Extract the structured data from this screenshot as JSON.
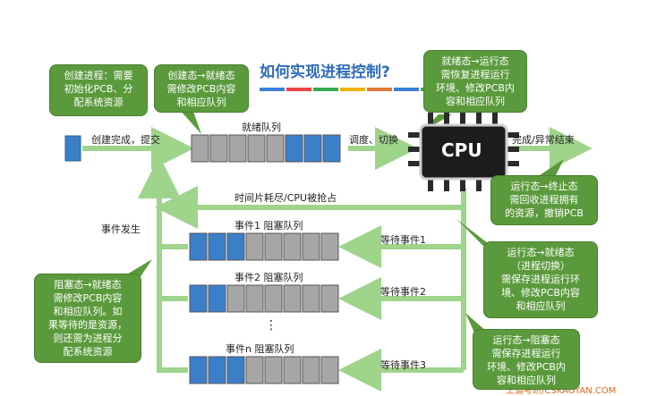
{
  "title": "如何实现进程控制?",
  "title_underline_colors": [
    "#3a7fd5",
    "#e44",
    "#3aaa55",
    "#f0b000",
    "#e07b39",
    "#3a7fd5",
    "#49a34a"
  ],
  "colors": {
    "queue_blue": "#3c7fc9",
    "queue_gray": "#a6a6a6",
    "arrow_green": "#9fd48b",
    "callout_green": "#5b9a3c"
  },
  "callouts": {
    "create": "创建进程：需要\n初始化PCB、分\n配系统资源",
    "ready_to_run_top": "创建态→就绪态\n需修改PCB内容\n和相应队列",
    "ready_to_run": "就绪态→运行态\n需恢复进程运行\n环境、修改PCB内\n容和相应队列",
    "terminate": "运行态→终止态\n需回收进程拥有\n的资源，撤销PCB",
    "run_to_ready": "运行态→就绪态\n（进程切换）\n需保存进程运行环\n境、修改PCB内容\n和相应队列",
    "blocked_to_ready": "阻塞态→就绪态\n需修改PCB内容\n和相应队列。如\n果等待的是资源，\n则还需为进程分\n配系统资源",
    "run_to_blocked": "运行态→阻塞态\n需保存进程运行\n环境、修改PCB内\n容和相应队列"
  },
  "labels": {
    "create_done": "创建完成，提交",
    "ready_queue": "就绪队列",
    "dispatch": "调度、切换",
    "cpu": "CPU",
    "finish": "完成/异常结束",
    "timeslice": "时间片耗尽/CPU被抢占",
    "event_occurs": "事件发生",
    "block_queue_1": "事件1 阻塞队列",
    "block_queue_2": "事件2 阻塞队列",
    "block_queue_n": "事件n 阻塞队列",
    "wait_event_1": "等待事件1",
    "wait_event_2": "等待事件2",
    "wait_event_3": "等待事件3",
    "ellipsis": "⋮",
    "watermark": "王道考研/CSKAOYAN.COM"
  },
  "queues": {
    "ready": [
      "gray",
      "gray",
      "gray",
      "gray",
      "gray",
      "blue",
      "blue",
      "blue"
    ],
    "block1": [
      "blue",
      "blue",
      "blue",
      "gray",
      "gray",
      "gray",
      "gray",
      "gray"
    ],
    "block2": [
      "blue",
      "blue",
      "gray",
      "gray",
      "gray",
      "gray",
      "gray",
      "gray"
    ],
    "blockn": [
      "blue",
      "blue",
      "blue",
      "gray",
      "gray",
      "gray",
      "gray",
      "gray"
    ]
  }
}
